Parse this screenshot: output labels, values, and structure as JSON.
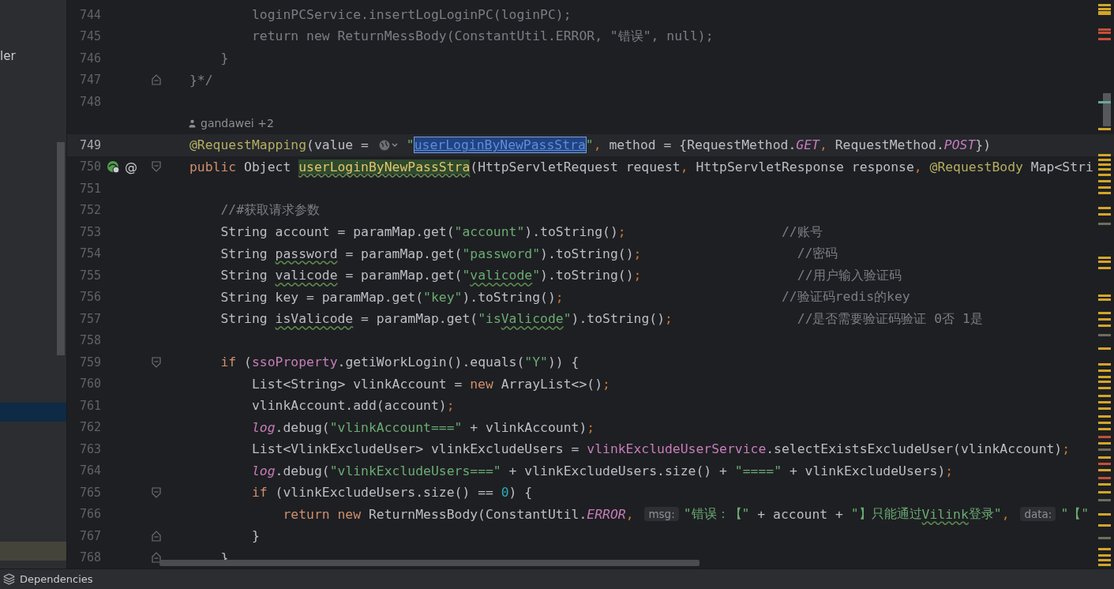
{
  "sidebar": {
    "label": "ler"
  },
  "editor": {
    "lines": [
      {
        "number": "744",
        "tokens": [
          {
            "kind": "comment",
            "text": "        loginPCService.insertLogLoginPC(loginPC);"
          }
        ]
      },
      {
        "number": "745",
        "tokens": [
          {
            "kind": "comment",
            "text": "        return new ReturnMessBody(ConstantUtil.ERROR, \"错误\", null);"
          }
        ]
      },
      {
        "number": "746",
        "tokens": [
          {
            "kind": "comment",
            "text": "    }"
          }
        ]
      },
      {
        "number": "747",
        "fold_end": true,
        "tokens": [
          {
            "kind": "comment",
            "text": "}*/"
          }
        ]
      },
      {
        "number": "748"
      },
      {
        "kind": "author",
        "text": "gandawei +2"
      },
      {
        "number": "749",
        "current": true,
        "tokens": [
          {
            "kind": "annotation",
            "text": "@RequestMapping"
          },
          {
            "kind": "plain",
            "text": "(value = "
          },
          {
            "kind": "web-icon"
          },
          {
            "kind": "string",
            "text": "\""
          },
          {
            "kind": "selected",
            "text": "userLoginByNewPassStra"
          },
          {
            "kind": "string",
            "text": "\""
          },
          {
            "kind": "punct",
            "text": ", "
          },
          {
            "kind": "plain",
            "text": "method = {RequestMethod."
          },
          {
            "kind": "static",
            "text": "GET"
          },
          {
            "kind": "punct",
            "text": ", "
          },
          {
            "kind": "plain",
            "text": "RequestMethod."
          },
          {
            "kind": "static",
            "text": "POST"
          },
          {
            "kind": "plain",
            "text": "})"
          }
        ]
      },
      {
        "number": "750",
        "endpoint": true,
        "gutter_text": "@",
        "fold_start": true,
        "tokens": [
          {
            "kind": "keyword",
            "text": "public "
          },
          {
            "kind": "plain",
            "text": "Object "
          },
          {
            "kind": "declaration",
            "text": "userLoginByNewPassStra"
          },
          {
            "kind": "plain",
            "text": "(HttpServletRequest request"
          },
          {
            "kind": "punct",
            "text": ", "
          },
          {
            "kind": "plain",
            "text": "HttpServletResponse response"
          },
          {
            "kind": "punct",
            "text": ", "
          },
          {
            "kind": "annotation",
            "text": "@RequestBody"
          },
          {
            "kind": "plain",
            "text": " Map<Stri"
          }
        ]
      },
      {
        "number": "751"
      },
      {
        "number": "752",
        "tokens": [
          {
            "kind": "comment",
            "text": "    //#获取请求参数"
          }
        ]
      },
      {
        "number": "753",
        "tokens": [
          {
            "kind": "plain",
            "text": "    String account = paramMap.get("
          },
          {
            "kind": "string",
            "text": "\"account\""
          },
          {
            "kind": "plain",
            "text": ").toString()"
          },
          {
            "kind": "punct",
            "text": ";"
          },
          {
            "kind": "comment",
            "text": "                    //账号"
          }
        ]
      },
      {
        "number": "754",
        "tokens": [
          {
            "kind": "plain",
            "text": "    String "
          },
          {
            "kind": "typo",
            "text": "password"
          },
          {
            "kind": "plain",
            "text": " = paramMap.get("
          },
          {
            "kind": "string",
            "text": "\"password\""
          },
          {
            "kind": "plain",
            "text": ").toString()"
          },
          {
            "kind": "punct",
            "text": ";"
          },
          {
            "kind": "comment",
            "text": "                    //密码"
          }
        ]
      },
      {
        "number": "755",
        "tokens": [
          {
            "kind": "plain",
            "text": "    String "
          },
          {
            "kind": "typo",
            "text": "valicode"
          },
          {
            "kind": "plain",
            "text": " = paramMap.get("
          },
          {
            "kind": "string",
            "text": "\""
          },
          {
            "kind": "string-typo",
            "text": "valicode"
          },
          {
            "kind": "string",
            "text": "\""
          },
          {
            "kind": "plain",
            "text": ").toString()"
          },
          {
            "kind": "punct",
            "text": ";"
          },
          {
            "kind": "comment",
            "text": "                    //用户输入验证码"
          }
        ]
      },
      {
        "number": "756",
        "tokens": [
          {
            "kind": "plain",
            "text": "    String key = paramMap.get("
          },
          {
            "kind": "string",
            "text": "\"key\""
          },
          {
            "kind": "plain",
            "text": ").toString()"
          },
          {
            "kind": "punct",
            "text": ";"
          },
          {
            "kind": "comment",
            "text": "                            //验证码redis的key"
          }
        ]
      },
      {
        "number": "757",
        "tokens": [
          {
            "kind": "plain",
            "text": "    String "
          },
          {
            "kind": "typo",
            "text": "isValicode"
          },
          {
            "kind": "plain",
            "text": " = paramMap.get("
          },
          {
            "kind": "string",
            "text": "\"is"
          },
          {
            "kind": "string-typo",
            "text": "Valicode"
          },
          {
            "kind": "string",
            "text": "\""
          },
          {
            "kind": "plain",
            "text": ").toString()"
          },
          {
            "kind": "punct",
            "text": ";"
          },
          {
            "kind": "comment",
            "text": "                //是否需要验证码验证 0否 1是"
          }
        ]
      },
      {
        "number": "758"
      },
      {
        "number": "759",
        "fold_start": true,
        "tokens": [
          {
            "kind": "keyword",
            "text": "    if "
          },
          {
            "kind": "plain",
            "text": "("
          },
          {
            "kind": "field",
            "text": "ssoProperty"
          },
          {
            "kind": "plain",
            "text": ".getiWorkLogin().equals("
          },
          {
            "kind": "string",
            "text": "\"Y\""
          },
          {
            "kind": "plain",
            "text": ")) {"
          }
        ]
      },
      {
        "number": "760",
        "tokens": [
          {
            "kind": "plain",
            "text": "        List<String> vlinkAccount = "
          },
          {
            "kind": "keyword",
            "text": "new "
          },
          {
            "kind": "plain",
            "text": "ArrayList<>()"
          },
          {
            "kind": "punct",
            "text": ";"
          }
        ]
      },
      {
        "number": "761",
        "tokens": [
          {
            "kind": "plain",
            "text": "        vlinkAccount.add(account)"
          },
          {
            "kind": "punct",
            "text": ";"
          }
        ]
      },
      {
        "number": "762",
        "tokens": [
          {
            "kind": "static",
            "text": "        log"
          },
          {
            "kind": "plain",
            "text": ".debug("
          },
          {
            "kind": "string",
            "text": "\"vlinkAccount===\""
          },
          {
            "kind": "plain",
            "text": " + vlinkAccount)"
          },
          {
            "kind": "punct",
            "text": ";"
          }
        ]
      },
      {
        "number": "763",
        "tokens": [
          {
            "kind": "plain",
            "text": "        List<VlinkExcludeUser> vlinkExcludeUsers = "
          },
          {
            "kind": "field",
            "text": "vlinkExcludeUserService"
          },
          {
            "kind": "plain",
            "text": ".selectExistsExcludeUser(vlinkAccount)"
          },
          {
            "kind": "punct",
            "text": ";"
          }
        ]
      },
      {
        "number": "764",
        "tokens": [
          {
            "kind": "static",
            "text": "        log"
          },
          {
            "kind": "plain",
            "text": ".debug("
          },
          {
            "kind": "string",
            "text": "\"vlinkExcludeUsers===\""
          },
          {
            "kind": "plain",
            "text": " + vlinkExcludeUsers.size() + "
          },
          {
            "kind": "string",
            "text": "\"====\""
          },
          {
            "kind": "plain",
            "text": " + vlinkExcludeUsers)"
          },
          {
            "kind": "punct",
            "text": ";"
          }
        ]
      },
      {
        "number": "765",
        "fold_start": true,
        "tokens": [
          {
            "kind": "keyword",
            "text": "        if "
          },
          {
            "kind": "plain",
            "text": "(vlinkExcludeUsers.size() == "
          },
          {
            "kind": "number",
            "text": "0"
          },
          {
            "kind": "plain",
            "text": ") {"
          }
        ]
      },
      {
        "number": "766",
        "tokens": [
          {
            "kind": "keyword",
            "text": "            return new "
          },
          {
            "kind": "plain",
            "text": "ReturnMessBody(ConstantUtil."
          },
          {
            "kind": "static",
            "text": "ERROR"
          },
          {
            "kind": "punct",
            "text": ", "
          },
          {
            "kind": "hint",
            "text": "msg:"
          },
          {
            "kind": "string",
            "text": "\"错误：【\""
          },
          {
            "kind": "plain",
            "text": " + account + "
          },
          {
            "kind": "string",
            "text": "\"】只能通过"
          },
          {
            "kind": "string-typo",
            "text": "Vilink"
          },
          {
            "kind": "string",
            "text": "登录\""
          },
          {
            "kind": "punct",
            "text": ", "
          },
          {
            "kind": "hint",
            "text": "data:"
          },
          {
            "kind": "string",
            "text": "\"【\""
          }
        ]
      },
      {
        "number": "767",
        "fold_end": true,
        "tokens": [
          {
            "kind": "plain",
            "text": "        }"
          }
        ]
      },
      {
        "number": "768",
        "fold_end": true,
        "tokens": [
          {
            "kind": "plain",
            "text": "    }"
          }
        ]
      }
    ]
  },
  "status_bar": {
    "label": "Dependencies"
  }
}
